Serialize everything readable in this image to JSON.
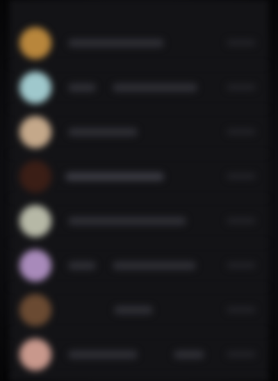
{
  "list": {
    "items": [
      {
        "avatar_color": "#b8863c",
        "title": "",
        "meta": ""
      },
      {
        "avatar_color": "#9fc8cc",
        "title": "",
        "meta": ""
      },
      {
        "avatar_color": "#c4a88a",
        "title": "",
        "meta": ""
      },
      {
        "avatar_color": "#3a1e16",
        "title": "",
        "meta": ""
      },
      {
        "avatar_color": "#b6b8a6",
        "title": "",
        "meta": ""
      },
      {
        "avatar_color": "#a88aba",
        "title": "",
        "meta": ""
      },
      {
        "avatar_color": "#6a4a32",
        "title": "",
        "meta": ""
      },
      {
        "avatar_color": "#c8988c",
        "title": "",
        "meta": ""
      }
    ]
  }
}
